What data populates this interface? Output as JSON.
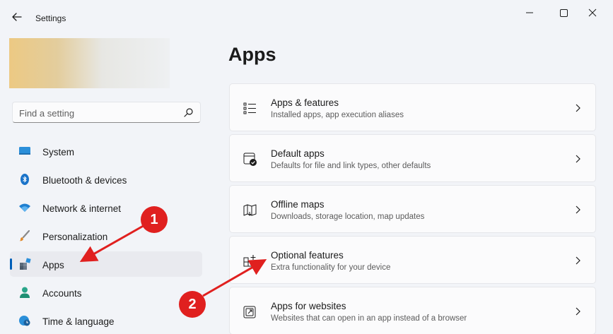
{
  "window": {
    "title": "Settings"
  },
  "search": {
    "placeholder": "Find a setting"
  },
  "sidebar": {
    "items": [
      {
        "label": "System",
        "icon": "system-icon"
      },
      {
        "label": "Bluetooth & devices",
        "icon": "bluetooth-icon"
      },
      {
        "label": "Network & internet",
        "icon": "wifi-icon"
      },
      {
        "label": "Personalization",
        "icon": "paintbrush-icon"
      },
      {
        "label": "Apps",
        "icon": "apps-icon",
        "active": true
      },
      {
        "label": "Accounts",
        "icon": "account-icon"
      },
      {
        "label": "Time & language",
        "icon": "globe-clock-icon"
      }
    ]
  },
  "main": {
    "title": "Apps",
    "cards": [
      {
        "title": "Apps & features",
        "subtitle": "Installed apps, app execution aliases",
        "icon": "list-icon"
      },
      {
        "title": "Default apps",
        "subtitle": "Defaults for file and link types, other defaults",
        "icon": "default-apps-icon"
      },
      {
        "title": "Offline maps",
        "subtitle": "Downloads, storage location, map updates",
        "icon": "map-icon"
      },
      {
        "title": "Optional features",
        "subtitle": "Extra functionality for your device",
        "icon": "optional-features-icon"
      },
      {
        "title": "Apps for websites",
        "subtitle": "Websites that can open in an app instead of a browser",
        "icon": "open-external-icon"
      }
    ]
  },
  "annotations": {
    "badge_1": "1",
    "badge_2": "2",
    "color": "#e0201f"
  },
  "colors": {
    "accent": "#005fb8",
    "background": "#f2f4f8",
    "card": "#fbfbfc"
  }
}
